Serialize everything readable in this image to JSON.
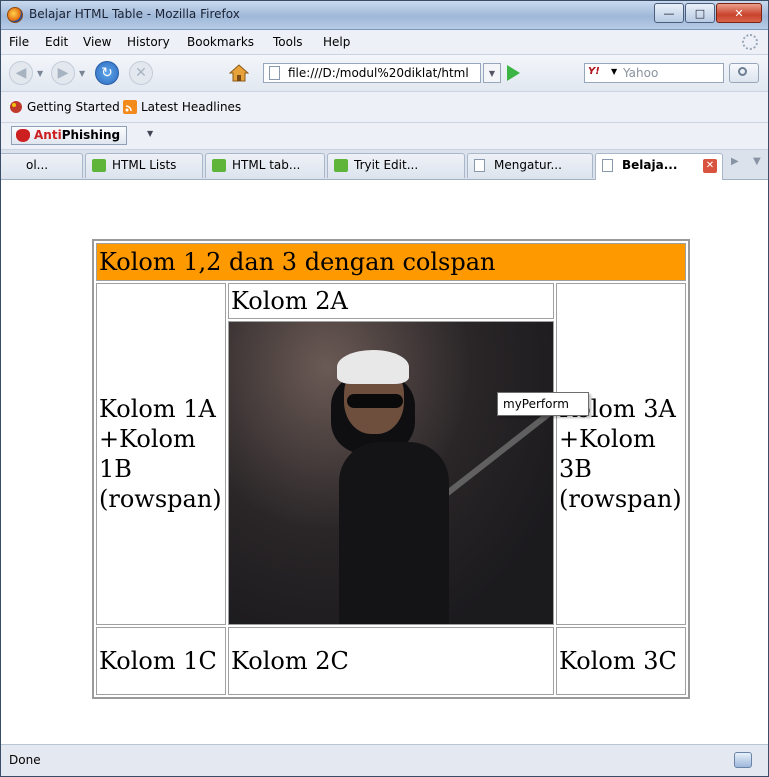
{
  "window": {
    "title": "Belajar HTML Table - Mozilla Firefox"
  },
  "menu": {
    "file": "File",
    "edit": "Edit",
    "view": "View",
    "history": "History",
    "bookmarks": "Bookmarks",
    "tools": "Tools",
    "help": "Help"
  },
  "nav": {
    "url": "file:///D:/modul%20diklat/html",
    "search_placeholder": "Yahoo",
    "search_engine_icon": "Y!"
  },
  "bookmarks": {
    "getting_started": "Getting Started",
    "latest_headlines": "Latest Headlines"
  },
  "antiphishing": {
    "label_red": "Anti",
    "label_rest": "Phishing"
  },
  "tabs": [
    {
      "label": "ol..."
    },
    {
      "label": "HTML Lists"
    },
    {
      "label": "HTML tab..."
    },
    {
      "label": "Tryit Edit..."
    },
    {
      "label": "Mengatur..."
    },
    {
      "label": "Belaja..."
    }
  ],
  "table": {
    "header": "Kolom 1,2 dan 3 dengan colspan",
    "c1ab": "Kolom 1A +Kolom 1B (rowspan)",
    "c2a": "Kolom 2A",
    "c3ab": "Kolom 3A +Kolom 3B (rowspan)",
    "c1c": "Kolom 1C",
    "c2c": "Kolom 2C",
    "c3c": "Kolom 3C"
  },
  "tooltip": "myPerform",
  "status": "Done"
}
